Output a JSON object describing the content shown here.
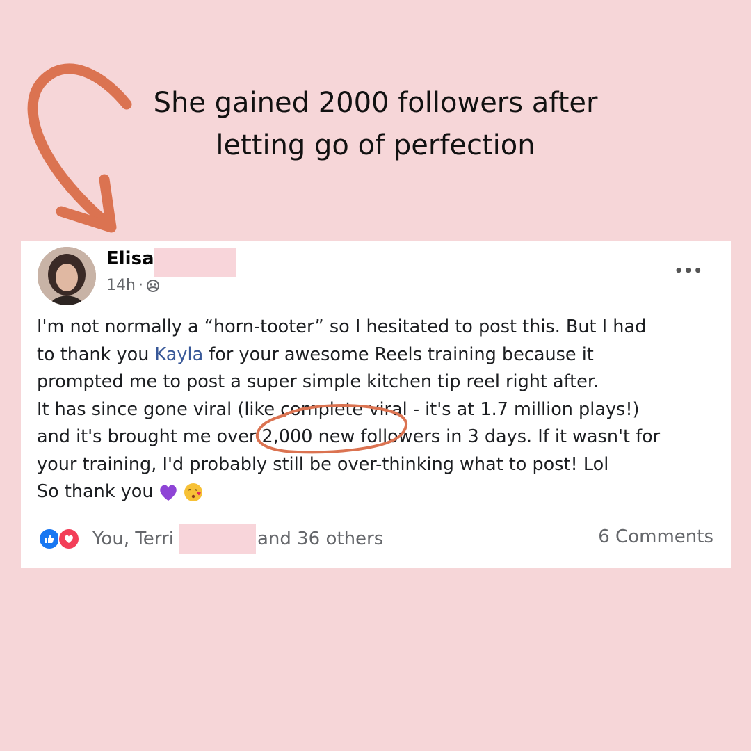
{
  "headline": {
    "line1": "She gained 2000 followers after",
    "line2": "letting go of perfection"
  },
  "colors": {
    "background": "#f6d6d8",
    "accent_annotation": "#db7351",
    "mention_link": "#385898",
    "like_blue": "#1877f2",
    "love_red": "#f33e58",
    "redaction": "#f8d5da"
  },
  "post": {
    "author_name": "Elisa",
    "timestamp": "14h",
    "separator": "·",
    "audience_icon": "friends-icon",
    "more_icon": "ellipsis-icon",
    "more_label": "•••",
    "body": {
      "line1": "I'm not normally a “horn-tooter” so I hesitated to post this. But I had",
      "line2_before": "to thank you ",
      "line2_mention": "Kayla",
      "line2_after": " for your awesome Reels training because it",
      "line3": "prompted me to post a super simple kitchen tip reel right after.",
      "line4": "It has since gone viral (like complete viral - it's at 1.7 million plays!)",
      "line5": "and it's brought me over 2,000 new followers in 3 days. If it wasn't for",
      "line6": "your training, I'd probably still be over-thinking what to post! Lol",
      "line7": "So thank you",
      "emojis": [
        "purple-heart-icon",
        "kissing-face-icon"
      ]
    },
    "reactions": {
      "icons": [
        "like-icon",
        "love-icon"
      ],
      "prefix": "You, Terri",
      "suffix": "and 36 others"
    },
    "comments_label": "6 Comments"
  }
}
